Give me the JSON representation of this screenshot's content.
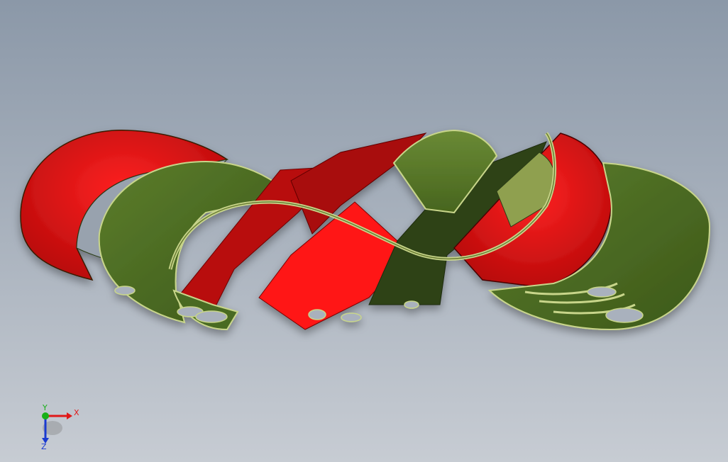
{
  "viewport": {
    "background_top": "#8b98a8",
    "background_bottom": "#c7ccd3"
  },
  "model": {
    "colors": {
      "red_face": "#cc1111",
      "red_bright": "#ff1a1a",
      "red_dark": "#8a0505",
      "green_face": "#4a6b22",
      "green_dark": "#2c3d16",
      "green_edge": "#c8d58a",
      "hole_fill": "#a9b1bd"
    }
  },
  "triad": {
    "x_label": "X",
    "y_label": "Y",
    "z_label": "Z",
    "x_color": "#e01818",
    "y_color": "#18b018",
    "z_color": "#1a3ad0"
  }
}
